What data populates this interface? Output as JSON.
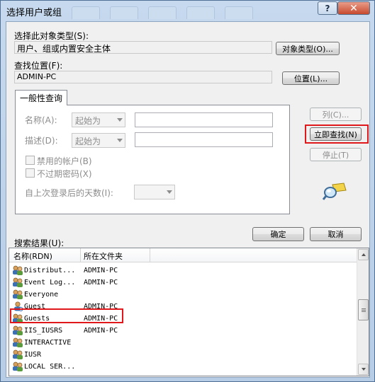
{
  "window": {
    "title": "选择用户或组",
    "help_label": "?",
    "close_label": "✕"
  },
  "object_type": {
    "label": "选择此对象类型(S):",
    "value": "用户、组或内置安全主体",
    "button": "对象类型(O)..."
  },
  "location": {
    "label": "查找位置(F):",
    "value": "ADMIN-PC",
    "button": "位置(L)..."
  },
  "query": {
    "tab_label": "一般性查询",
    "name_label": "名称(A):",
    "name_mode": "起始为",
    "desc_label": "描述(D):",
    "desc_mode": "起始为",
    "disabled_accounts": "禁用的帐户(B)",
    "non_expiring_pwd": "不过期密码(X)",
    "days_since_login": "自上次登录后的天数(I):"
  },
  "side_buttons": {
    "columns": "列(C)...",
    "find_now": "立即查找(N)",
    "stop": "停止(T)"
  },
  "footer_buttons": {
    "ok": "确定",
    "cancel": "取消"
  },
  "results": {
    "label": "搜索结果(U):",
    "columns": [
      "名称(RDN)",
      "所在文件夹"
    ],
    "rows": [
      {
        "name": "Distribut...",
        "folder": "ADMIN-PC",
        "icon": "group-icon"
      },
      {
        "name": "Event Log...",
        "folder": "ADMIN-PC",
        "icon": "group-icon"
      },
      {
        "name": "Everyone",
        "folder": "",
        "icon": "group-icon"
      },
      {
        "name": "Guest",
        "folder": "ADMIN-PC",
        "icon": "user-icon"
      },
      {
        "name": "Guests",
        "folder": "ADMIN-PC",
        "icon": "group-icon"
      },
      {
        "name": "IIS_IUSRS",
        "folder": "ADMIN-PC",
        "icon": "group-icon"
      },
      {
        "name": "INTERACTIVE",
        "folder": "",
        "icon": "group-icon"
      },
      {
        "name": "IUSR",
        "folder": "",
        "icon": "group-icon"
      },
      {
        "name": "LOCAL SER...",
        "folder": "",
        "icon": "group-icon"
      }
    ]
  },
  "colors": {
    "highlight": "#e0181c",
    "title_bg": "#b7cde6",
    "dialog_bg": "#f0f0f0"
  }
}
